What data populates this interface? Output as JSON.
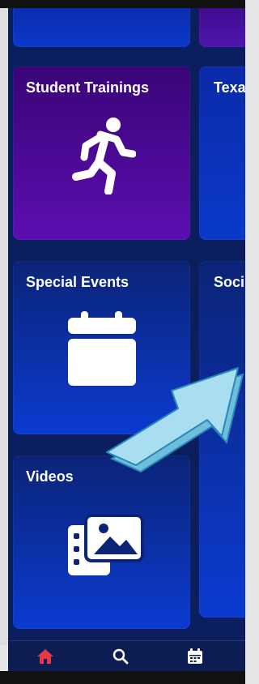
{
  "tiles": [
    {
      "label": ""
    },
    {
      "label": ""
    },
    {
      "label": "Student Trainings"
    },
    {
      "label": "Texa"
    },
    {
      "label": "Special Events"
    },
    {
      "label": "Soci"
    },
    {
      "label": "Videos"
    }
  ],
  "colors": {
    "nav_active": "#e63946",
    "nav_inactive": "#ffffff",
    "arrow_fill": "#9fd8ec"
  },
  "bottom_nav": [
    {
      "icon": "home-icon",
      "active": true
    },
    {
      "icon": "search-icon",
      "active": false
    },
    {
      "icon": "calendar-icon",
      "active": false
    }
  ]
}
